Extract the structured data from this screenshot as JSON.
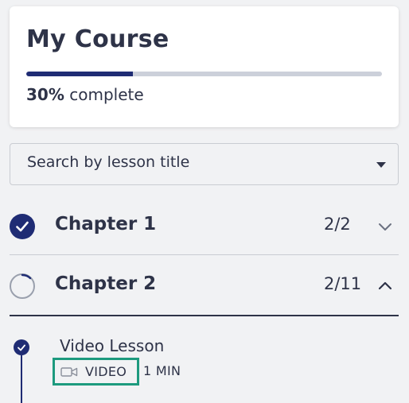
{
  "course": {
    "title": "My Course",
    "progress_percent": 30,
    "progress_value": "30%",
    "progress_suffix": "complete"
  },
  "search": {
    "label": "Search by lesson title"
  },
  "chapters": [
    {
      "title": "Chapter 1",
      "progress": "2/2",
      "status": "complete",
      "expanded": false
    },
    {
      "title": "Chapter 2",
      "progress": "2/11",
      "status": "in-progress",
      "expanded": true
    }
  ],
  "lessons": [
    {
      "title": "Video Lesson",
      "type": "VIDEO",
      "duration": "1 MIN",
      "status": "complete"
    }
  ],
  "colors": {
    "primary": "#1f2c74",
    "text": "#2e3348",
    "highlight": "#1d9a7e",
    "background": "#f1f2f4"
  }
}
